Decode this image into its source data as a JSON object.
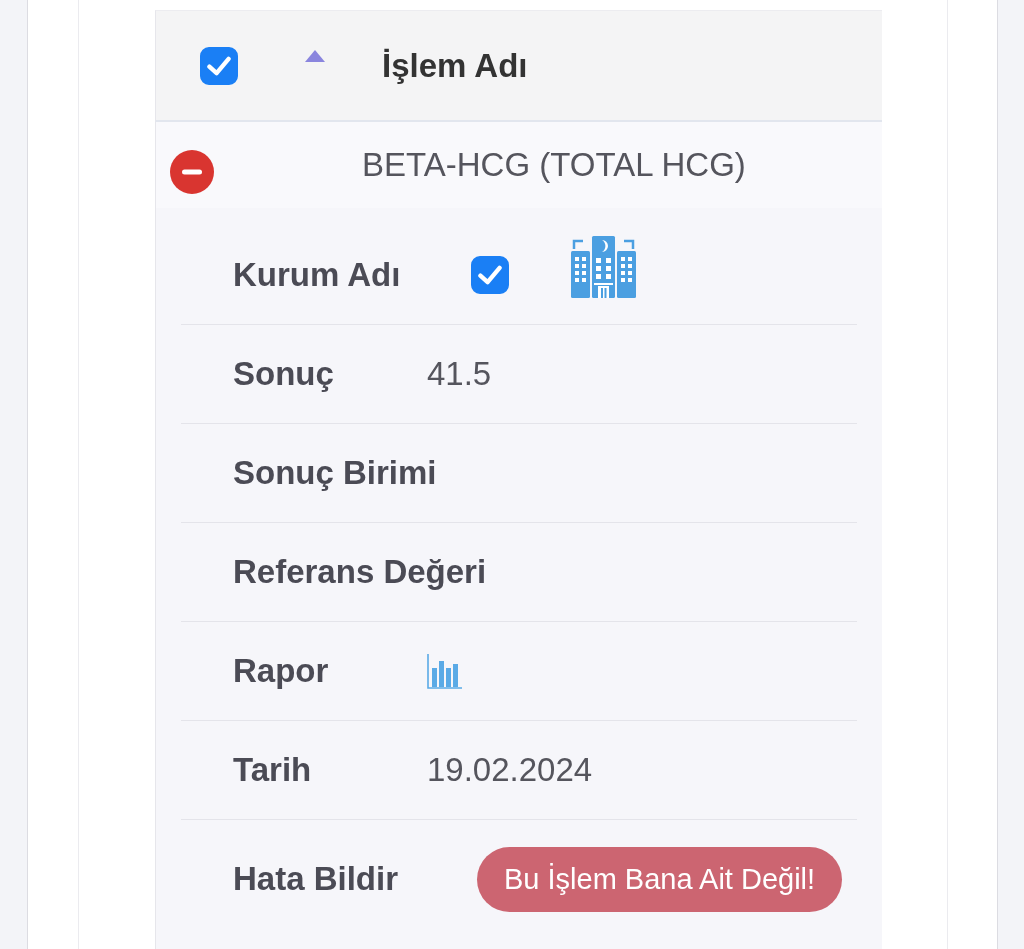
{
  "table": {
    "header": {
      "select_all_checked": true,
      "sort_ascending": true,
      "column": "İşlem Adı"
    },
    "rows": [
      {
        "name": "BETA-HCG (TOTAL HCG)",
        "expanded": true,
        "details": [
          {
            "kind": "institution",
            "label": "Kurum Adı",
            "checked": true
          },
          {
            "kind": "text",
            "label": "Sonuç",
            "value": "41.5"
          },
          {
            "kind": "text",
            "label": "Sonuç Birimi"
          },
          {
            "kind": "text",
            "label": "Referans Değeri"
          },
          {
            "kind": "report",
            "label": "Rapor"
          },
          {
            "kind": "text",
            "label": "Tarih",
            "value": "19.02.2024"
          },
          {
            "kind": "action",
            "label": "Hata Bildir",
            "button": "Bu İşlem Bana Ait Değil!"
          }
        ]
      }
    ]
  }
}
